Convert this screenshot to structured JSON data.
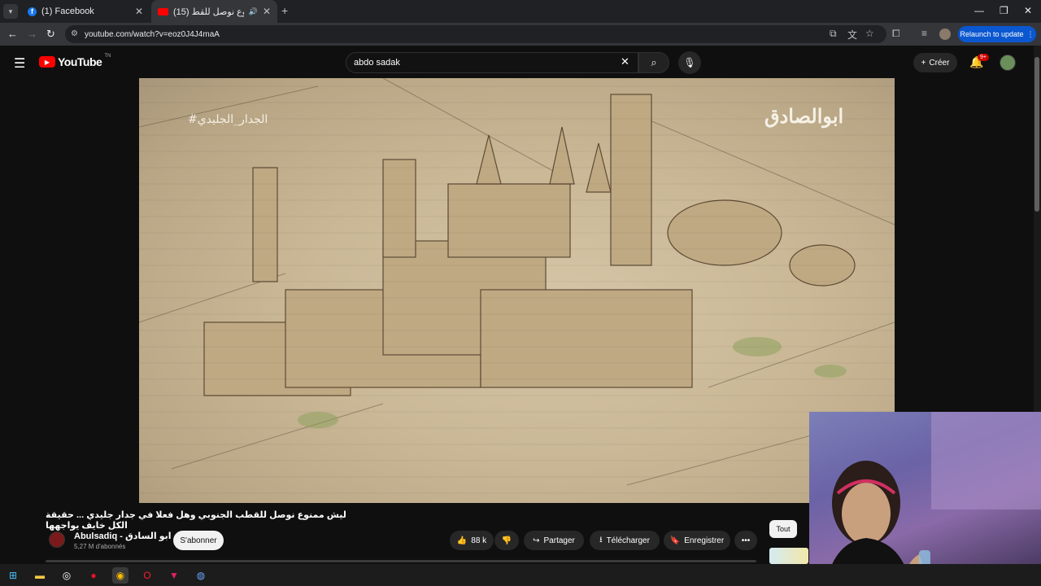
{
  "browser": {
    "tabs": [
      {
        "label": "(1) Facebook",
        "favicon": "facebook-icon",
        "active": false
      },
      {
        "label": "(15) ليش ممنوع نوصل للقط...",
        "favicon": "youtube-icon",
        "active": true
      }
    ],
    "url": "youtube.com/watch?v=eoz0J4J4maA",
    "relaunch_label": "Relaunch to update"
  },
  "youtube": {
    "logo_text": "YouTube",
    "logo_region": "TN",
    "search_value": "abdo sadak",
    "create_label": "Créer",
    "notification_count": "9+"
  },
  "video": {
    "watermark_left": "#الجدار_الجليدي",
    "watermark_right": "ابوالصادق",
    "title": "ليش ممنوع نوصل للقطب الجنوبي وهل فعلا في جدار جليدي ... حقيقة الكل خايف يواجهها",
    "channel_name": "Abulsadiq - ابو السادق",
    "subscribers": "5,27 M d'abonnés",
    "subscribe_label": "S'abonner",
    "likes": "88 k",
    "share_label": "Partager",
    "download_label": "Télécharger",
    "save_label": "Enregistrer"
  },
  "sidebar": {
    "chip_all": "Tout"
  },
  "colors": {
    "youtube_red": "#ff0000",
    "page_bg": "#0f0f0f",
    "chrome_blue": "#0b57d0"
  }
}
